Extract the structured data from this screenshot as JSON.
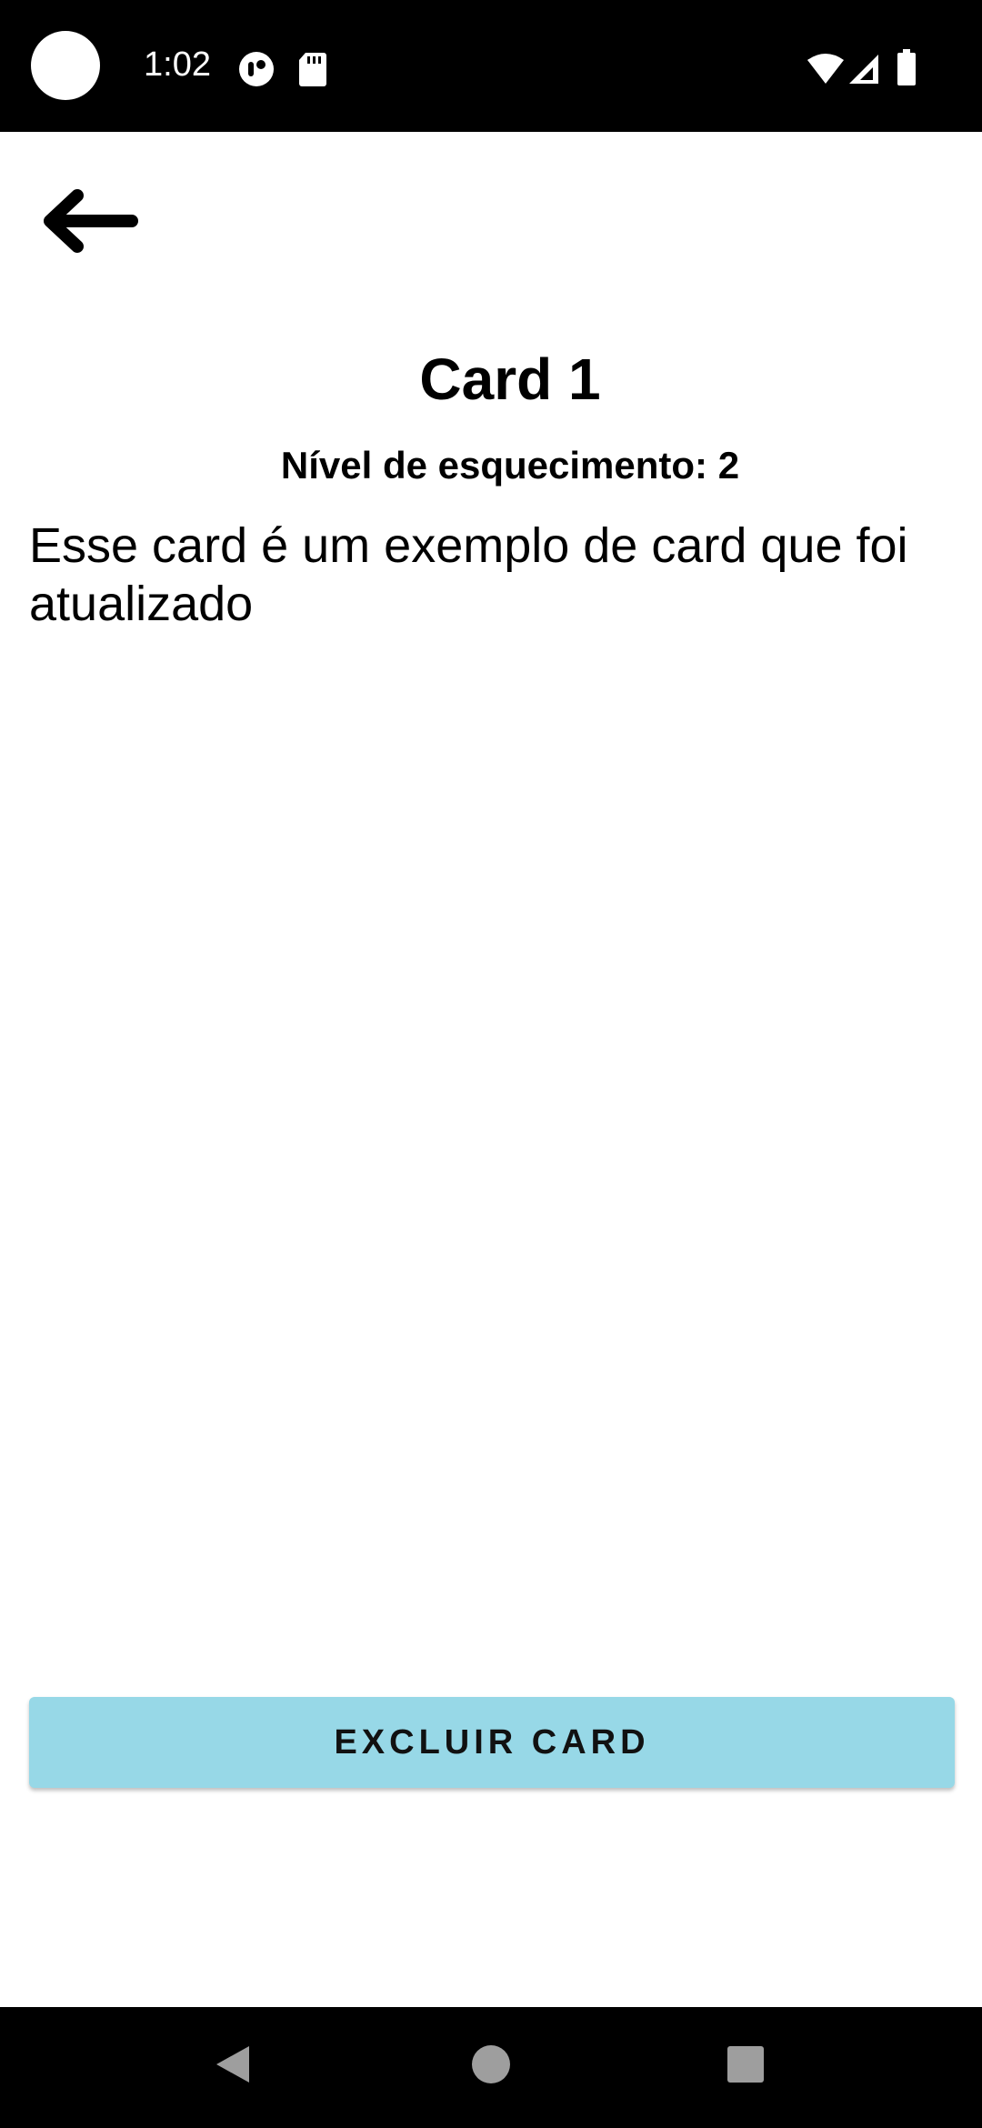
{
  "status_bar": {
    "time": "1:02",
    "icons": [
      "camera-cutout",
      "assistant-icon",
      "sd-card-icon",
      "wifi-icon",
      "signal-icon",
      "battery-icon"
    ]
  },
  "header": {
    "back_icon": "arrow-left-icon"
  },
  "card": {
    "title": "Card 1",
    "level": "Nível de esquecimento: 2",
    "body": "Esse card é um exemplo de card que foi atualizado"
  },
  "actions": {
    "delete_label": "EXCLUIR CARD",
    "delete_color": "#97d8e7"
  },
  "nav_bar": {
    "icons": [
      "back-triangle-icon",
      "home-circle-icon",
      "recents-square-icon"
    ]
  }
}
